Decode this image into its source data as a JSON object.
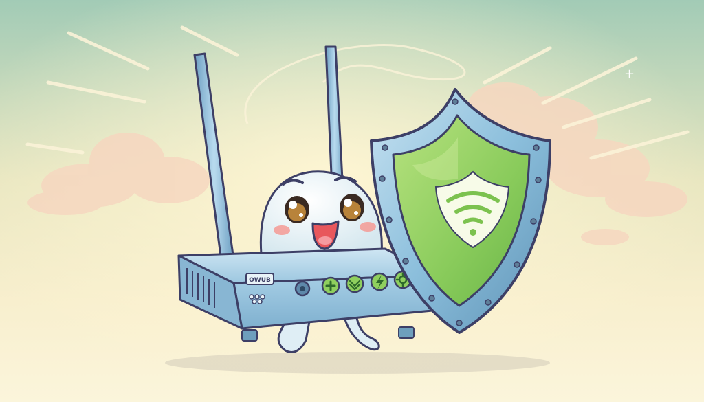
{
  "image": {
    "subject": "cartoon-wifi-router-with-shield",
    "colors": {
      "sky_top": "#9dc8b4",
      "sky_mid": "#f4ecc4",
      "ground": "#faf4d6",
      "router_body": "#a9d0e6",
      "router_shadow": "#6e9fbd",
      "outline": "#3d3f66",
      "shield_rim": "#7fb2d2",
      "shield_face": "#8fcf5e",
      "shield_face_light": "#b6e27e",
      "accent_green": "#67b84a",
      "cheek": "#f59a94",
      "mouth": "#e8575c"
    },
    "router_label": "OWUB",
    "icons": [
      "plus-icon",
      "chevron-down-icon",
      "lightning-icon",
      "gear-icon"
    ]
  }
}
